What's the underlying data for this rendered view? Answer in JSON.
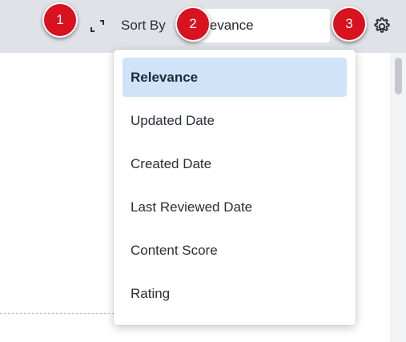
{
  "toolbar": {
    "sort_label": "Sort By",
    "sort_value": "levance",
    "expand_icon": "expand-icon",
    "settings_icon": "gear-icon"
  },
  "markers": [
    "1",
    "2",
    "3"
  ],
  "dropdown": {
    "options": [
      "Relevance",
      "Updated Date",
      "Created Date",
      "Last Reviewed Date",
      "Content Score",
      "Rating"
    ],
    "selected": "Relevance"
  },
  "colors": {
    "toolbar_bg": "#dfe3e8",
    "marker_red": "#d8121e",
    "selected_bg": "#cfe4f9"
  }
}
